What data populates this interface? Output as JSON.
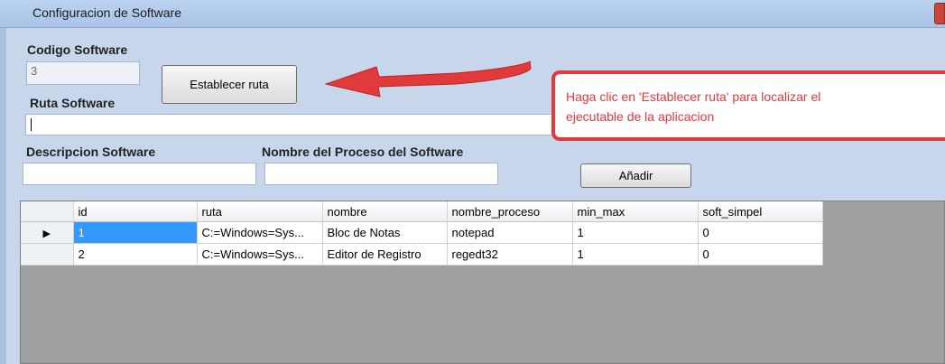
{
  "window": {
    "title": "Configuracion de Software"
  },
  "form": {
    "codigo_label": "Codigo Software",
    "codigo_value": "3",
    "establecer_button": "Establecer ruta",
    "ruta_label": "Ruta Software",
    "ruta_value": "",
    "descripcion_label": "Descripcion Software",
    "descripcion_value": "",
    "proceso_label": "Nombre del Proceso del Software",
    "proceso_value": "",
    "anadir_button": "Añadir"
  },
  "annotation": {
    "callout_line1": "Haga clic en 'Establecer ruta' para localizar el",
    "callout_line2": "ejecutable de la aplicacion",
    "arrow_color": "#e2393a"
  },
  "grid": {
    "columns": [
      "id",
      "ruta",
      "nombre",
      "nombre_proceso",
      "min_max",
      "soft_simpel"
    ],
    "rows": [
      [
        "1",
        "C:=Windows=Sys...",
        "Bloc de Notas",
        "notepad",
        "1",
        "0"
      ],
      [
        "2",
        "C:=Windows=Sys...",
        "Editor de Registro",
        "regedt32",
        "1",
        "0"
      ]
    ],
    "current_row_indicator": "▶"
  },
  "colors": {
    "form_background": "#c7d6ea",
    "selected_cell": "#3399ff"
  }
}
